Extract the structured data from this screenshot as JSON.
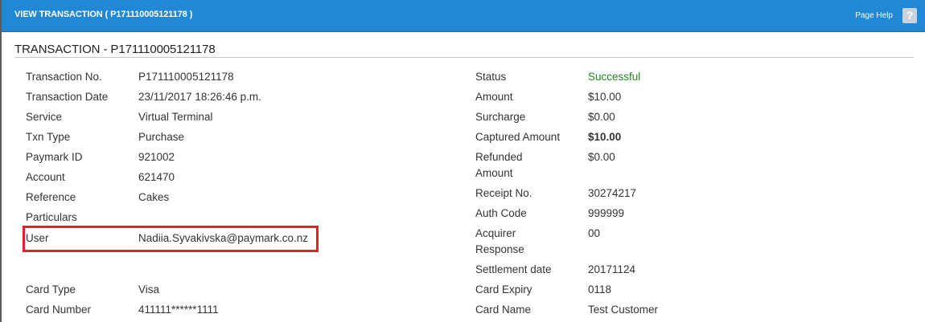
{
  "header": {
    "title": "VIEW TRANSACTION ( P171110005121178 )",
    "page_help": "Page Help",
    "help_glyph": "?"
  },
  "section": {
    "title": "TRANSACTION - P171110005121178"
  },
  "left": {
    "transaction_no": {
      "label": "Transaction No.",
      "value": "P171110005121178"
    },
    "transaction_date": {
      "label": "Transaction Date",
      "value": "23/11/2017 18:26:46 p.m."
    },
    "service": {
      "label": "Service",
      "value": "Virtual Terminal"
    },
    "txn_type": {
      "label": "Txn Type",
      "value": "Purchase"
    },
    "paymark_id": {
      "label": "Paymark ID",
      "value": "921002"
    },
    "account": {
      "label": "Account",
      "value": "621470"
    },
    "reference": {
      "label": "Reference",
      "value": "Cakes"
    },
    "particulars": {
      "label": "Particulars",
      "value": ""
    },
    "user": {
      "label": "User",
      "value": "Nadiia.Syvakivska@paymark.co.nz"
    },
    "card_type": {
      "label": "Card Type",
      "value": "Visa"
    },
    "card_number": {
      "label": "Card Number",
      "value": "411111******1111"
    }
  },
  "right": {
    "status": {
      "label": "Status",
      "value": "Successful"
    },
    "amount": {
      "label": "Amount",
      "value": "$10.00"
    },
    "surcharge": {
      "label": "Surcharge",
      "value": "$0.00"
    },
    "captured_amount": {
      "label": "Captured Amount",
      "value": "$10.00"
    },
    "refunded_amount": {
      "label_line1": "Refunded",
      "label_line2": "Amount",
      "value": "$0.00"
    },
    "receipt_no": {
      "label": "Receipt No.",
      "value": "30274217"
    },
    "auth_code": {
      "label": "Auth Code",
      "value": "999999"
    },
    "acquirer_response": {
      "label_line1": "Acquirer",
      "label_line2": "Response",
      "value": "00"
    },
    "settlement_date": {
      "label": "Settlement date",
      "value": "20171124"
    },
    "card_expiry": {
      "label": "Card Expiry",
      "value": "0118"
    },
    "card_name": {
      "label": "Card Name",
      "value": "Test Customer"
    }
  },
  "colors": {
    "header_bg": "#2188d6",
    "success": "#1c8a1c",
    "highlight": "#e3202c"
  }
}
